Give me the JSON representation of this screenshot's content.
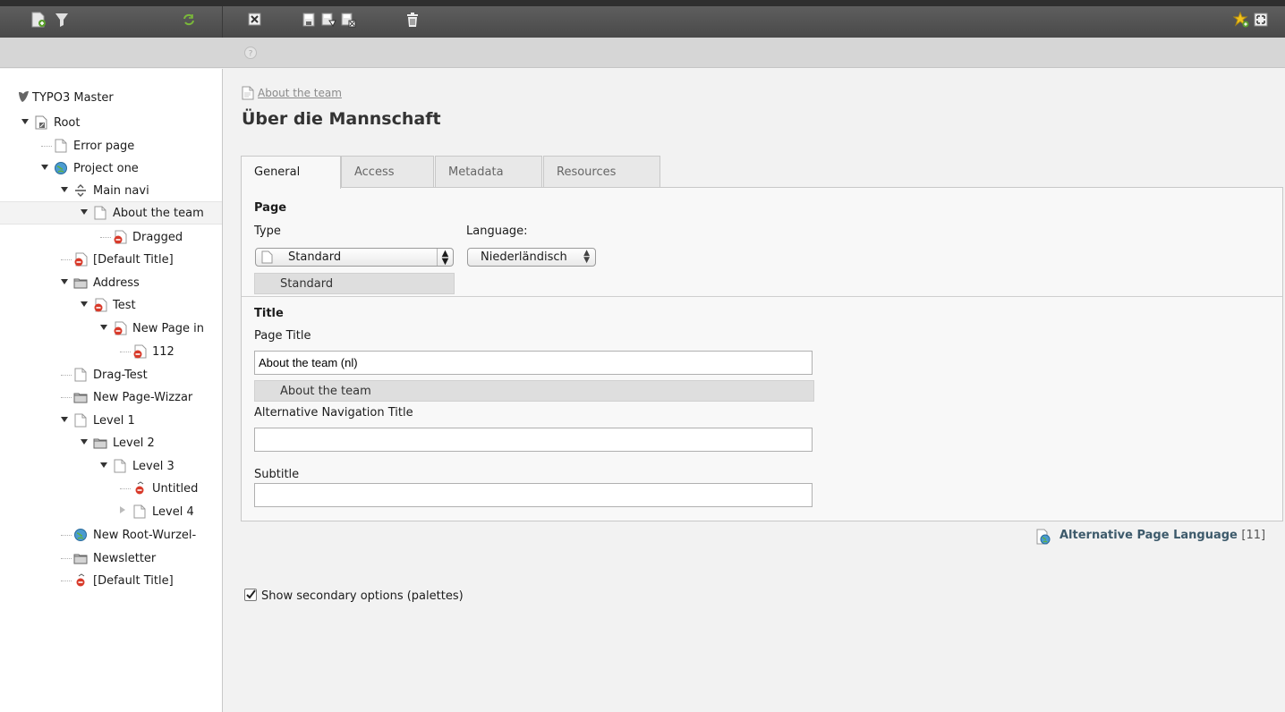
{
  "toolbar": {
    "left_icons": [
      "new-page-icon",
      "filter-icon",
      "refresh-icon"
    ],
    "doc_icons": [
      "close-doc-icon",
      "save-icon",
      "save-view-icon",
      "save-close-icon",
      "delete-icon"
    ],
    "right_icons": [
      "bookmark-star-icon",
      "fullscreen-icon"
    ]
  },
  "tree": {
    "root_label": "TYPO3 Master",
    "items": [
      {
        "label": "Root",
        "icon": "root-page-icon"
      },
      {
        "label": "Error page",
        "icon": "page-icon"
      },
      {
        "label": "Project one",
        "icon": "globe-icon"
      },
      {
        "label": "Main navi",
        "icon": "separator-icon"
      },
      {
        "label": "About the team",
        "icon": "page-icon"
      },
      {
        "label": "Dragged",
        "icon": "hidden-page-icon"
      },
      {
        "label": "[Default Title]",
        "icon": "hidden-page-icon"
      },
      {
        "label": "Address",
        "icon": "folder-icon"
      },
      {
        "label": "Test",
        "icon": "hidden-page-icon"
      },
      {
        "label": "New Page in",
        "icon": "hidden-page-icon"
      },
      {
        "label": "112",
        "icon": "hidden-page-icon"
      },
      {
        "label": "Drag-Test",
        "icon": "page-icon"
      },
      {
        "label": "New Page-Wizzar",
        "icon": "folder-icon"
      },
      {
        "label": "Level 1",
        "icon": "page-icon"
      },
      {
        "label": "Level 2",
        "icon": "folder-icon"
      },
      {
        "label": "Level 3",
        "icon": "page-icon"
      },
      {
        "label": "Untitled",
        "icon": "hidden-separator-icon"
      },
      {
        "label": "Level 4",
        "icon": "page-icon"
      },
      {
        "label": "New Root-Wurzel-",
        "icon": "globe-icon"
      },
      {
        "label": "Newsletter",
        "icon": "folder-icon"
      },
      {
        "label": "[Default Title]",
        "icon": "hidden-separator-icon"
      }
    ]
  },
  "main": {
    "breadcrumb": "About the team",
    "title": "Über die Mannschaft",
    "tabs": [
      "General",
      "Access",
      "Metadata",
      "Resources"
    ],
    "page_section": {
      "title": "Page",
      "type_label": "Type",
      "type_value": "Standard",
      "type_original": "Standard",
      "language_label": "Language:",
      "language_value": "Niederländisch"
    },
    "title_section": {
      "title": "Title",
      "page_title_label": "Page Title",
      "page_title_value": "About the team (nl)",
      "page_title_original": "About the team",
      "nav_title_label": "Alternative Navigation Title",
      "nav_title_value": "",
      "subtitle_label": "Subtitle",
      "subtitle_value": ""
    },
    "alt_language": {
      "label": "Alternative Page Language",
      "count": "[11]"
    },
    "secondary_options": {
      "label": "Show secondary options (palettes)",
      "checked": true
    }
  },
  "colors": {
    "toolbar": "#4f4f4f",
    "hidden_page": "#d83a2a",
    "link_text": "#3d5a6b"
  }
}
